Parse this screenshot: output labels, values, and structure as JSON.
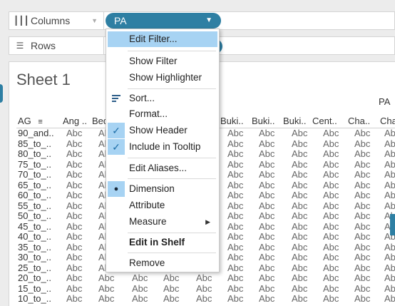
{
  "shelves": {
    "columns": {
      "label": "Columns",
      "icon": "columns-icon"
    },
    "rows": {
      "label": "Rows",
      "icon": "rows-icon"
    }
  },
  "pill": {
    "label": "PA"
  },
  "sheet": {
    "title": "Sheet 1",
    "top_header": "PA",
    "row_header": "AG",
    "column_headers": [
      "Ang ..",
      "Bed",
      "",
      "",
      "Buki..",
      "Buki..",
      "Buki..",
      "Cent..",
      "Cha..",
      "Cha"
    ],
    "row_labels": [
      "90_and..",
      "85_to_..",
      "80_to_..",
      "75_to_..",
      "70_to_..",
      "65_to_..",
      "60_to_..",
      "55_to_..",
      "50_to_..",
      "45_to_..",
      "40_to_..",
      "35_to_..",
      "30_to_..",
      "25_to_..",
      "20_to_..",
      "15_to_..",
      "10_to_.."
    ],
    "cell_text": "Abc"
  },
  "menu": {
    "items": [
      {
        "label": "Edit Filter...",
        "highlighted": true
      },
      {
        "label": "Show Filter"
      },
      {
        "label": "Show Highlighter"
      },
      {
        "label": "Sort..."
      },
      {
        "label": "Format..."
      },
      {
        "label": "Show Header",
        "checked": true
      },
      {
        "label": "Include in Tooltip",
        "checked": true
      },
      {
        "label": "Edit Aliases..."
      },
      {
        "label": "Dimension",
        "selected": true
      },
      {
        "label": "Attribute"
      },
      {
        "label": "Measure",
        "submenu": true
      },
      {
        "label": "Edit in Shelf",
        "bold": true
      },
      {
        "label": "Remove"
      }
    ]
  },
  "colors": {
    "accent": "#2e7fa3",
    "highlight": "#a7d3f3"
  }
}
